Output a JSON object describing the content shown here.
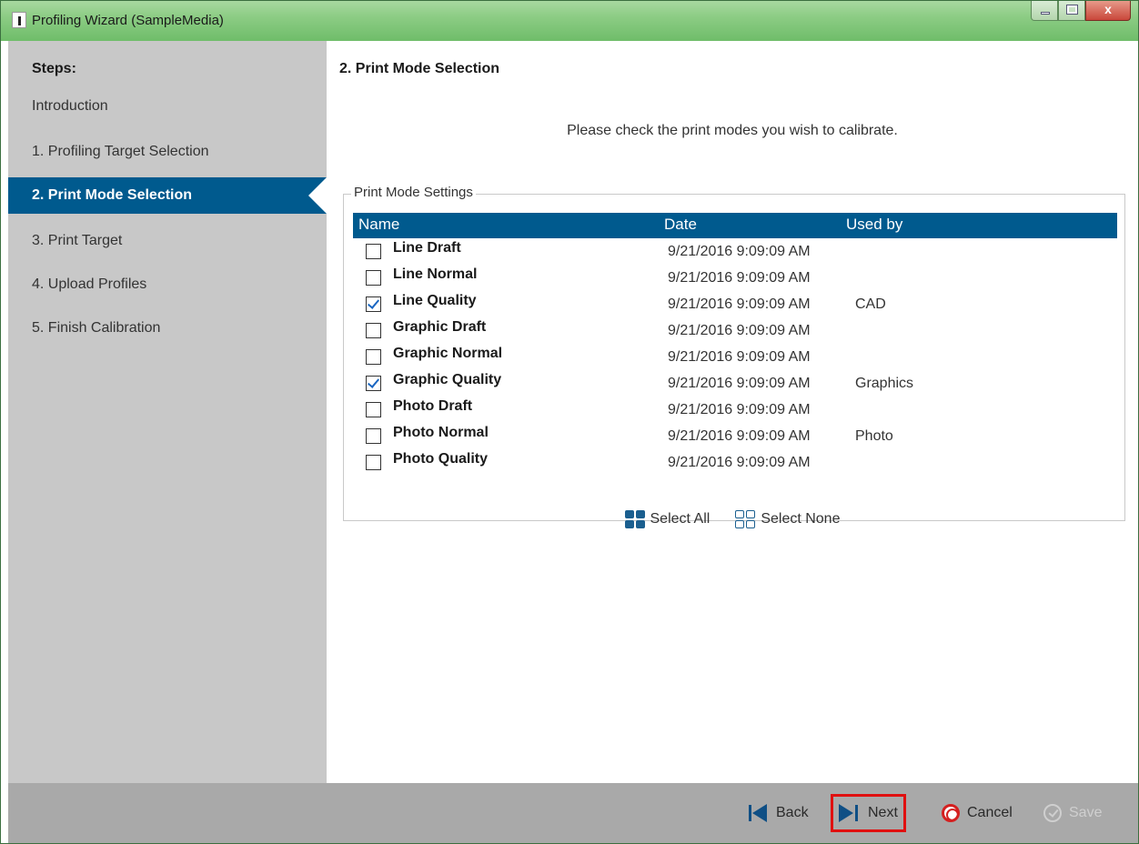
{
  "window": {
    "title": "Profiling Wizard (SampleMedia)",
    "close_glyph": "x"
  },
  "sidebar": {
    "header": "Steps:",
    "items": [
      {
        "label": "Introduction",
        "active": false
      },
      {
        "label": "1. Profiling Target Selection",
        "active": false
      },
      {
        "label": "2. Print Mode Selection",
        "active": true
      },
      {
        "label": "3. Print Target",
        "active": false
      },
      {
        "label": "4. Upload Profiles",
        "active": false
      },
      {
        "label": "5. Finish Calibration",
        "active": false
      }
    ]
  },
  "main": {
    "title": "2. Print Mode Selection",
    "instructions": "Please check the print modes you wish to calibrate.",
    "group_label": "Print Mode Settings",
    "columns": {
      "name": "Name",
      "date": "Date",
      "used_by": "Used by"
    },
    "rows": [
      {
        "name": "Line Draft",
        "checked": false,
        "date": "9/21/2016 9:09:09 AM",
        "used_by": ""
      },
      {
        "name": "Line Normal",
        "checked": false,
        "date": "9/21/2016 9:09:09 AM",
        "used_by": ""
      },
      {
        "name": "Line Quality",
        "checked": true,
        "date": "9/21/2016 9:09:09 AM",
        "used_by": "CAD"
      },
      {
        "name": "Graphic Draft",
        "checked": false,
        "date": "9/21/2016 9:09:09 AM",
        "used_by": ""
      },
      {
        "name": "Graphic Normal",
        "checked": false,
        "date": "9/21/2016 9:09:09 AM",
        "used_by": ""
      },
      {
        "name": "Graphic Quality",
        "checked": true,
        "date": "9/21/2016 9:09:09 AM",
        "used_by": "Graphics"
      },
      {
        "name": "Photo Draft",
        "checked": false,
        "date": "9/21/2016 9:09:09 AM",
        "used_by": ""
      },
      {
        "name": "Photo Normal",
        "checked": false,
        "date": "9/21/2016 9:09:09 AM",
        "used_by": "Photo"
      },
      {
        "name": "Photo Quality",
        "checked": false,
        "date": "9/21/2016 9:09:09 AM",
        "used_by": ""
      }
    ],
    "select_all_label": "Select All",
    "select_none_label": "Select None"
  },
  "footer": {
    "back_label": "Back",
    "next_label": "Next",
    "cancel_label": "Cancel",
    "save_label": "Save",
    "save_enabled": false,
    "next_highlighted": true
  },
  "colors": {
    "accent": "#005a8e",
    "sidebar_bg": "#c8c8c8",
    "footer_bg": "#a9a9a9",
    "highlight": "#e01010"
  }
}
